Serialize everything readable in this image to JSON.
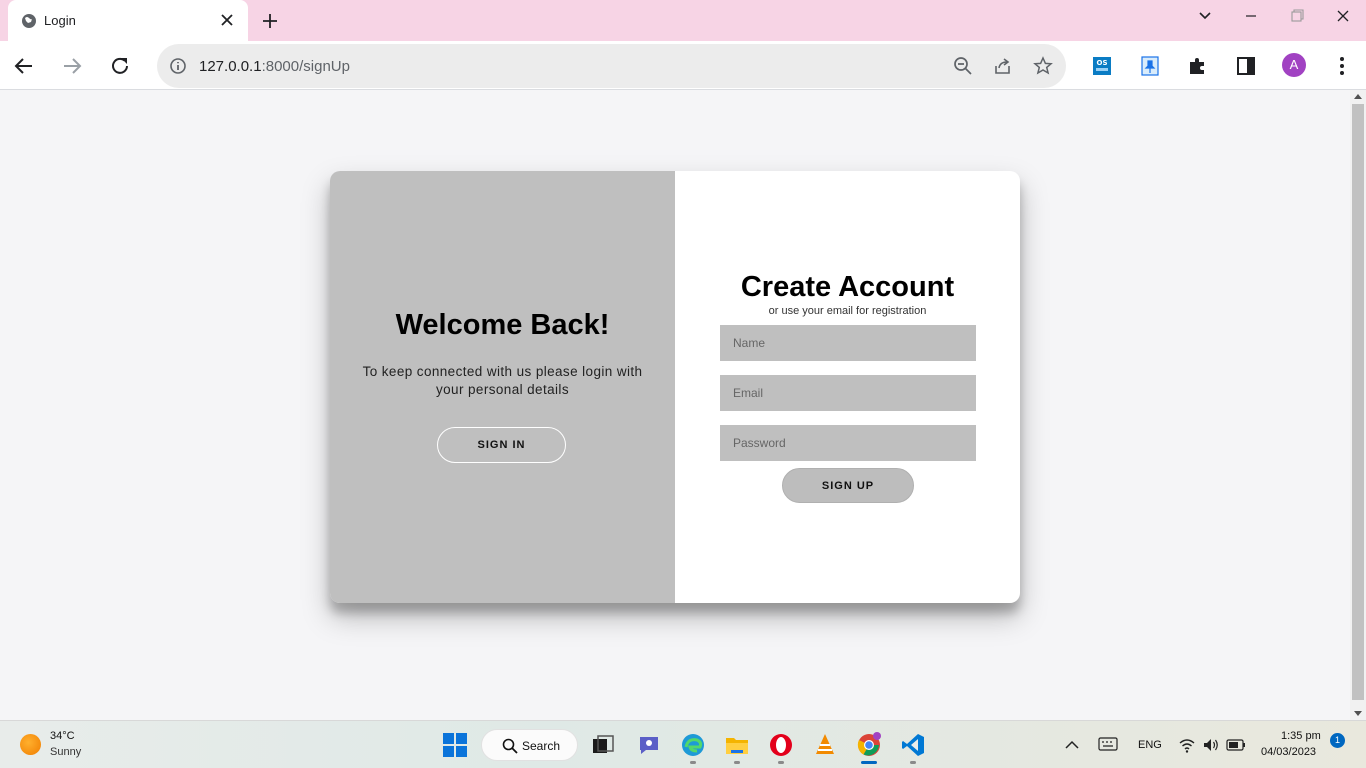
{
  "browser": {
    "tab_title": "Login",
    "url_host": "127.0.0.1",
    "url_rest": ":8000/signUp",
    "avatar_letter": "A"
  },
  "overlay": {
    "title": "Welcome Back!",
    "text": "To keep connected with us please login with your personal details",
    "button": "SIGN IN"
  },
  "form": {
    "title": "Create Account",
    "subtitle": "or use your email for registration",
    "name_placeholder": "Name",
    "email_placeholder": "Email",
    "password_placeholder": "Password",
    "button": "SIGN UP"
  },
  "taskbar": {
    "temperature": "34°C",
    "condition": "Sunny",
    "search_label": "Search",
    "language": "ENG",
    "time": "1:35 pm",
    "date": "04/03/2023",
    "notifications": "1"
  },
  "colors": {
    "tabbar": "#f7d4e5",
    "overlay": "#bfbfbf",
    "accent": "#0067c0"
  }
}
